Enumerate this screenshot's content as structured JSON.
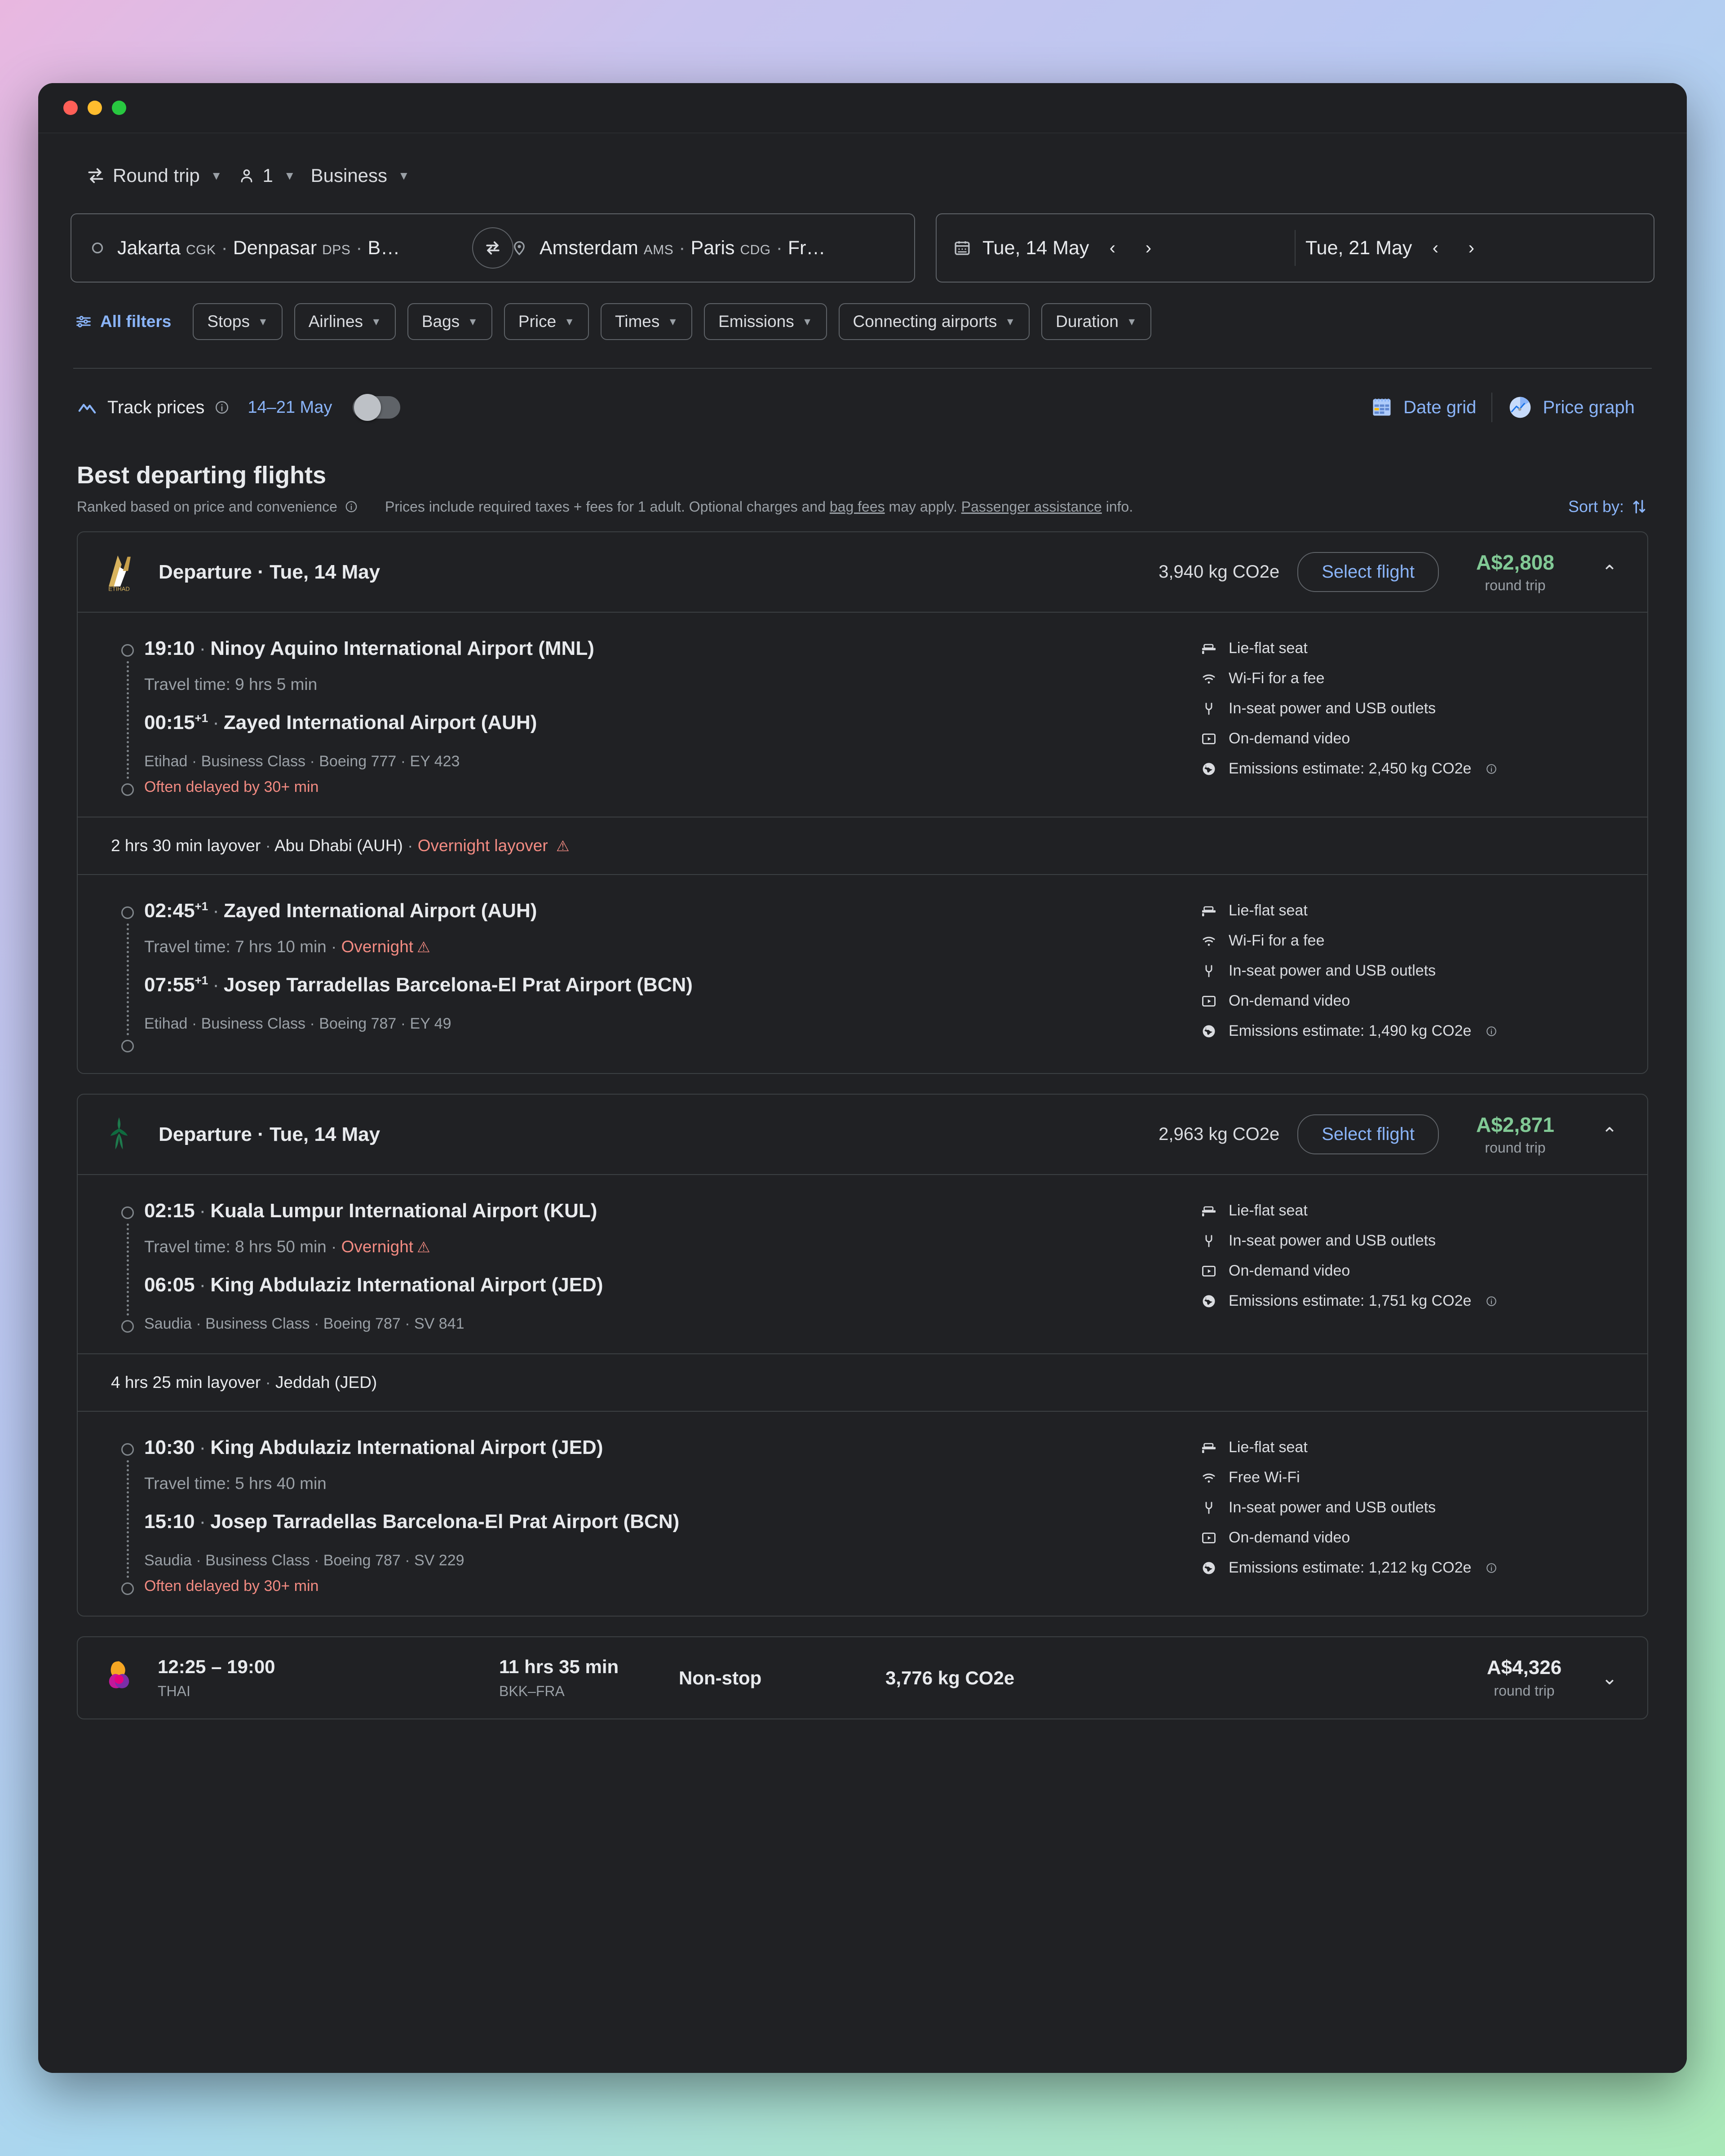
{
  "trip_controls": {
    "trip_type": "Round trip",
    "passengers": "1",
    "cabin_class": "Business"
  },
  "search": {
    "origin_text": "Jakarta CGK · Denpasar DPS · B…",
    "origin_parts": [
      {
        "city": "Jakarta",
        "code": "CGK"
      },
      {
        "city": "Denpasar",
        "code": "DPS"
      },
      {
        "city": "B…",
        "code": ""
      }
    ],
    "destination_parts": [
      {
        "city": "Amsterdam",
        "code": "AMS"
      },
      {
        "city": "Paris",
        "code": "CDG"
      },
      {
        "city": "Fr…",
        "code": ""
      }
    ],
    "depart_date": "Tue, 14 May",
    "return_date": "Tue, 21 May"
  },
  "filters": {
    "all_filters_label": "All filters",
    "chips": [
      "Stops",
      "Airlines",
      "Bags",
      "Price",
      "Times",
      "Emissions",
      "Connecting airports",
      "Duration"
    ]
  },
  "track_prices": {
    "label": "Track prices",
    "date_range": "14–21 May",
    "toggle_on": false
  },
  "view_toggles": {
    "date_grid": "Date grid",
    "price_graph": "Price graph"
  },
  "section": {
    "title": "Best departing flights",
    "ranked_note": "Ranked based on price and convenience",
    "disclaimer_a": "Prices include required taxes + fees for 1 adult. Optional charges and ",
    "disclaimer_link1": "bag fees",
    "disclaimer_b": " may apply. ",
    "disclaimer_link2": "Passenger assistance",
    "disclaimer_c": " info.",
    "sort_by": "Sort by:"
  },
  "flights": [
    {
      "airline_logo": "etihad-logo",
      "header_label": "Departure · Tue, 14 May",
      "co2": "3,940 kg CO2e",
      "select_label": "Select flight",
      "price": "A$2,808",
      "price_sub": "round trip",
      "expanded": true,
      "legs": [
        {
          "depart_time": "19:10",
          "depart_sup": "",
          "depart_airport": "Ninoy Aquino International Airport (MNL)",
          "travel_time": "Travel time: 9 hrs 5 min",
          "travel_warn": "",
          "arrive_time": "00:15",
          "arrive_sup": "+1",
          "arrive_airport": "Zayed International Airport (AUH)",
          "meta": "Etihad · Business Class · Boeing 777 · EY 423",
          "delay": "Often delayed by 30+ min",
          "amenities": [
            {
              "icon": "lie-flat-seat-icon",
              "label": "Lie-flat seat"
            },
            {
              "icon": "wifi-icon",
              "label": "Wi-Fi for a fee"
            },
            {
              "icon": "power-outlet-icon",
              "label": "In-seat power and USB outlets"
            },
            {
              "icon": "video-icon",
              "label": "On-demand video"
            },
            {
              "icon": "emissions-globe-icon",
              "label": "Emissions estimate: 2,450 kg CO2e"
            }
          ]
        },
        {
          "depart_time": "02:45",
          "depart_sup": "+1",
          "depart_airport": "Zayed International Airport (AUH)",
          "travel_time": "Travel time: 7 hrs 10 min",
          "travel_warn": "Overnight",
          "arrive_time": "07:55",
          "arrive_sup": "+1",
          "arrive_airport": "Josep Tarradellas Barcelona-El Prat Airport (BCN)",
          "meta": "Etihad · Business Class · Boeing 787 · EY 49",
          "delay": "",
          "amenities": [
            {
              "icon": "lie-flat-seat-icon",
              "label": "Lie-flat seat"
            },
            {
              "icon": "wifi-icon",
              "label": "Wi-Fi for a fee"
            },
            {
              "icon": "power-outlet-icon",
              "label": "In-seat power and USB outlets"
            },
            {
              "icon": "video-icon",
              "label": "On-demand video"
            },
            {
              "icon": "emissions-globe-icon",
              "label": "Emissions estimate: 1,490 kg CO2e"
            }
          ]
        }
      ],
      "layovers": [
        {
          "duration": "2 hrs 30 min layover",
          "airport": "Abu Dhabi (AUH)",
          "warn": "Overnight layover"
        }
      ]
    },
    {
      "airline_logo": "saudia-logo",
      "header_label": "Departure · Tue, 14 May",
      "co2": "2,963 kg CO2e",
      "select_label": "Select flight",
      "price": "A$2,871",
      "price_sub": "round trip",
      "expanded": true,
      "legs": [
        {
          "depart_time": "02:15",
          "depart_sup": "",
          "depart_airport": "Kuala Lumpur International Airport (KUL)",
          "travel_time": "Travel time: 8 hrs 50 min",
          "travel_warn": "Overnight",
          "arrive_time": "06:05",
          "arrive_sup": "",
          "arrive_airport": "King Abdulaziz International Airport (JED)",
          "meta": "Saudia · Business Class · Boeing 787 · SV 841",
          "delay": "",
          "amenities": [
            {
              "icon": "lie-flat-seat-icon",
              "label": "Lie-flat seat"
            },
            {
              "icon": "power-outlet-icon",
              "label": "In-seat power and USB outlets"
            },
            {
              "icon": "video-icon",
              "label": "On-demand video"
            },
            {
              "icon": "emissions-globe-icon",
              "label": "Emissions estimate: 1,751 kg CO2e"
            }
          ]
        },
        {
          "depart_time": "10:30",
          "depart_sup": "",
          "depart_airport": "King Abdulaziz International Airport (JED)",
          "travel_time": "Travel time: 5 hrs 40 min",
          "travel_warn": "",
          "arrive_time": "15:10",
          "arrive_sup": "",
          "arrive_airport": "Josep Tarradellas Barcelona-El Prat Airport (BCN)",
          "meta": "Saudia · Business Class · Boeing 787 · SV 229",
          "delay": "Often delayed by 30+ min",
          "amenities": [
            {
              "icon": "lie-flat-seat-icon",
              "label": "Lie-flat seat"
            },
            {
              "icon": "wifi-icon",
              "label": "Free Wi-Fi"
            },
            {
              "icon": "power-outlet-icon",
              "label": "In-seat power and USB outlets"
            },
            {
              "icon": "video-icon",
              "label": "On-demand video"
            },
            {
              "icon": "emissions-globe-icon",
              "label": "Emissions estimate: 1,212 kg CO2e"
            }
          ]
        }
      ],
      "layovers": [
        {
          "duration": "4 hrs 25 min layover",
          "airport": "Jeddah (JED)",
          "warn": ""
        }
      ]
    }
  ],
  "compact_flight": {
    "airline_logo": "thai-logo",
    "times": "12:25 – 19:00",
    "airline": "THAI",
    "duration": "11 hrs 35 min",
    "route": "BKK–FRA",
    "stops": "Non-stop",
    "co2": "3,776 kg CO2e",
    "price": "A$4,326",
    "price_sub": "round trip"
  },
  "colors": {
    "accent_blue": "#8ab4f8",
    "price_green": "#81c995",
    "warn_red": "#f28b82",
    "bg": "#202124"
  }
}
